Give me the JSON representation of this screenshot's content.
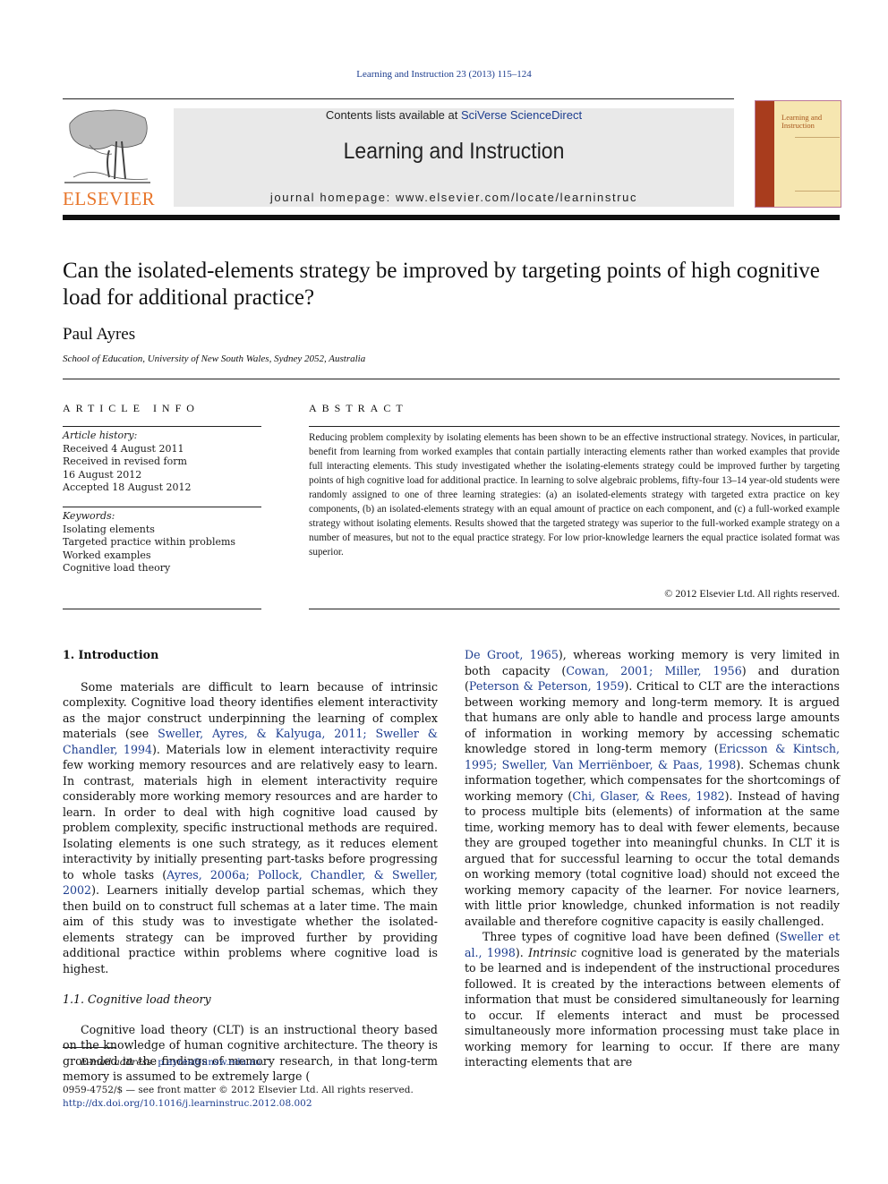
{
  "header": {
    "journal_ref": "Learning and Instruction 23 (2013) 115–124",
    "contents_prefix": "Contents lists available at ",
    "contents_link": "SciVerse ScienceDirect",
    "journal_title": "Learning and Instruction",
    "homepage_label": "journal homepage: ",
    "homepage_url": "www.elsevier.com/locate/learninstruc",
    "publisher_wordmark": "ELSEVIER",
    "cover_title_line1": "Learning and",
    "cover_title_line2": "Instruction",
    "colors": {
      "brand_orange": "#e8762b",
      "link_blue": "#1c3d8f",
      "cover_spine": "#a83c1d",
      "cover_bg": "#f6e6b0"
    }
  },
  "article": {
    "title": "Can the isolated-elements strategy be improved by targeting points of high cognitive load for additional practice?",
    "author": "Paul Ayres",
    "affiliation": "School of Education, University of New South Wales, Sydney 2052, Australia"
  },
  "article_info": {
    "heading": "ARTICLE INFO",
    "history_label": "Article history:",
    "history": [
      "Received 4 August 2011",
      "Received in revised form",
      "16 August 2012",
      "Accepted 18 August 2012"
    ],
    "keywords_label": "Keywords:",
    "keywords": [
      "Isolating elements",
      "Targeted practice within problems",
      "Worked examples",
      "Cognitive load theory"
    ]
  },
  "abstract": {
    "heading": "ABSTRACT",
    "text": "Reducing problem complexity by isolating elements has been shown to be an effective instructional strategy. Novices, in particular, benefit from learning from worked examples that contain partially interacting elements rather than worked examples that provide full interacting elements. This study investigated whether the isolating-elements strategy could be improved further by targeting points of high cognitive load for additional practice. In learning to solve algebraic problems, fifty-four 13–14 year-old students were randomly assigned to one of three learning strategies: (a) an isolated-elements strategy with targeted extra practice on key components, (b) an isolated-elements strategy with an equal amount of practice on each component, and (c) a full-worked example strategy without isolating elements. Results showed that the targeted strategy was superior to the full-worked example strategy on a number of measures, but not to the equal practice strategy. For low prior-knowledge learners the equal practice isolated format was superior.",
    "copyright": "© 2012 Elsevier Ltd. All rights reserved."
  },
  "body": {
    "section1_heading": "1.  Introduction",
    "p1": {
      "a": "Some materials are difficult to learn because of intrinsic complexity. Cognitive load theory identifies element interactivity as the major construct underpinning the learning of complex materials (see ",
      "c1": "Sweller, Ayres, & Kalyuga, 2011; Sweller & Chandler, 1994",
      "b": "). Materials low in element interactivity require few working memory resources and are relatively easy to learn. In contrast, materials high in element interactivity require considerably more working memory resources and are harder to learn. In order to deal with high cognitive load caused by problem complexity, specific instructional methods are required. Isolating elements is one such strategy, as it reduces element interactivity by initially presenting part-tasks before progressing to whole tasks (",
      "c2": "Ayres, 2006a; Pollock, Chandler, & Sweller, 2002",
      "c": "). Learners initially develop partial schemas, which they then build on to construct full schemas at a later time. The main aim of this study was to investigate whether the isolated-elements strategy can be improved further by providing additional practice within problems where cognitive load is highest."
    },
    "section11_heading": "1.1.  Cognitive load theory",
    "p2": {
      "a": "Cognitive load theory (CLT) is an instructional theory based on the knowledge of human cognitive architecture. The theory is grounded in the findings of memory research, in that long-term memory is assumed to be extremely large (",
      "c1": "De Groot, 1965",
      "b": "), whereas working memory is very limited in both capacity (",
      "c2": "Cowan, 2001; Miller, 1956",
      "c": ") and duration (",
      "c3": "Peterson & Peterson, 1959",
      "d": "). Critical to CLT are the interactions between working memory and long-term memory. It is argued that humans are only able to handle and process large amounts of information in working memory by accessing schematic knowledge stored in long-term memory (",
      "c4": "Ericsson & Kintsch, 1995; Sweller, Van Merriënboer, & Paas, 1998",
      "e": "). Schemas chunk information together, which compensates for the shortcomings of working memory (",
      "c5": "Chi, Glaser, & Rees, 1982",
      "f": "). Instead of having to process multiple bits (elements) of information at the same time, working memory has to deal with fewer elements, because they are grouped together into meaningful chunks. In CLT it is argued that for successful learning to occur the total demands on working memory (total cognitive load) should not exceed the working memory capacity of the learner. For novice learners, with little prior knowledge, chunked information is not readily available and therefore cognitive capacity is easily challenged."
    },
    "p3": {
      "a": "Three types of cognitive load have been defined (",
      "c1": "Sweller et al., 1998",
      "b": "). ",
      "em": "Intrinsic",
      "c": " cognitive load is generated by the materials to be learned and is independent of the instructional procedures followed. It is created by the interactions between elements of information that must be considered simultaneously for learning to occur. If elements interact and must be processed simultaneously more information processing must take place in working memory for learning to occur. If there are many interacting elements that are"
    }
  },
  "footer": {
    "email_label": "E-mail address:",
    "email": "p.ayres@unsw.edu.au",
    "email_suffix": ".",
    "issn_line": "0959-4752/$ — see front matter © 2012 Elsevier Ltd. All rights reserved.",
    "doi": "http://dx.doi.org/10.1016/j.learninstruc.2012.08.002"
  }
}
